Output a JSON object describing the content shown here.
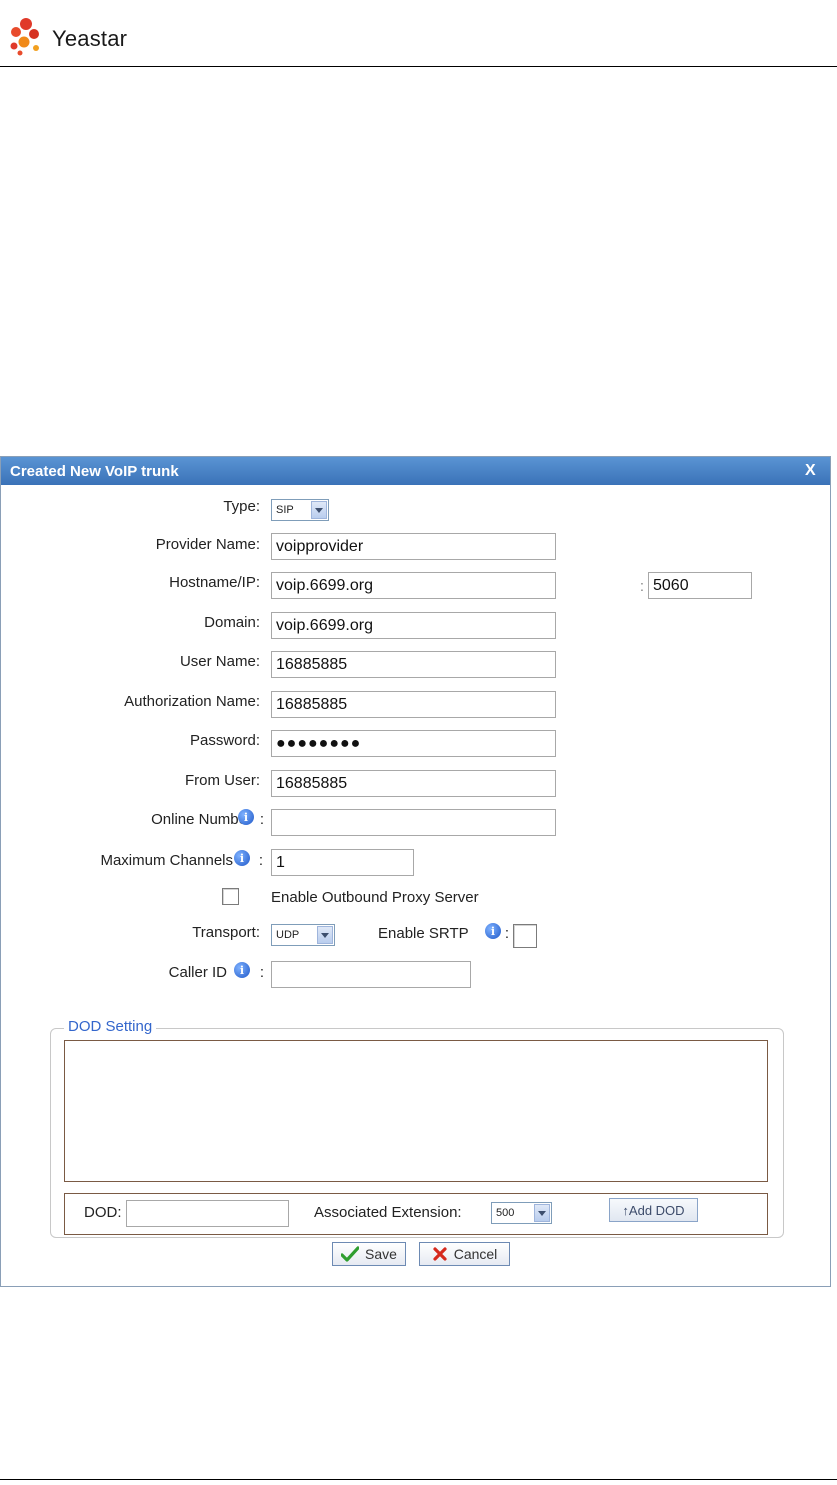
{
  "brand": {
    "name": "Yeastar",
    "logo_icon": "yeastar-logo-icon"
  },
  "dialog": {
    "title": "Created New VoIP trunk",
    "close_label": "X",
    "form": {
      "type_label": "Type:",
      "type_value": "SIP",
      "provider_name_label": "Provider Name:",
      "provider_name_value": "voipprovider",
      "hostname_label": "Hostname/IP:",
      "hostname_value": "voip.6699.org",
      "port_sep": ":",
      "port_value": "5060",
      "domain_label": "Domain:",
      "domain_value": "voip.6699.org",
      "user_name_label": "User Name:",
      "user_name_value": "16885885",
      "auth_name_label": "Authorization Name:",
      "auth_name_value": "16885885",
      "password_label": "Password:",
      "password_value": "●●●●●●●●",
      "from_user_label": "From User:",
      "from_user_value": "16885885",
      "online_number_label": "Online Number",
      "online_number_value": "",
      "max_channels_label": "Maximum Channels",
      "max_channels_value": "1",
      "outbound_proxy_label": "Enable Outbound Proxy Server",
      "outbound_proxy_checked": false,
      "transport_label": "Transport:",
      "transport_value": "UDP",
      "srtp_label": "Enable SRTP",
      "srtp_checked": false,
      "caller_id_label": "Caller ID",
      "caller_id_value": "",
      "colon": ":"
    },
    "dod": {
      "legend": "DOD Setting",
      "dod_label": "DOD:",
      "dod_value": "",
      "assoc_ext_label": "Associated Extension:",
      "assoc_ext_value": "500",
      "add_button": "↑Add DOD"
    },
    "buttons": {
      "save": "Save",
      "cancel": "Cancel"
    }
  },
  "colors": {
    "title_bar": "#3a72b8",
    "legend": "#3366cc",
    "dod_border": "#7a5a44"
  }
}
